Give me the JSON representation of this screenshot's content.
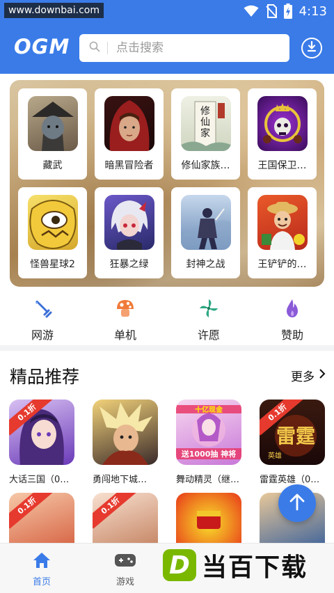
{
  "status_bar": {
    "watermark": "www.downbai.com",
    "time": "4:13"
  },
  "header": {
    "logo": "OGM",
    "search_placeholder": "点击搜索"
  },
  "featured": [
    {
      "name": "藏武",
      "icon": "ronin-portrait"
    },
    {
      "name": "暗黑冒险者",
      "icon": "red-hood-portrait"
    },
    {
      "name": "修仙家族…",
      "icon": "calligraphy-scroll"
    },
    {
      "name": "王国保卫…",
      "icon": "skull-tower"
    },
    {
      "name": "怪兽星球2",
      "icon": "yellow-monster"
    },
    {
      "name": "狂暴之绿",
      "icon": "white-hair-girl"
    },
    {
      "name": "封神之战",
      "icon": "knight-silhouette"
    },
    {
      "name": "王铲铲的…",
      "icon": "farmer-character"
    }
  ],
  "categories": [
    {
      "label": "网游",
      "icon": "sword-icon",
      "color": "#3a6fd8"
    },
    {
      "label": "单机",
      "icon": "mushroom-icon",
      "color": "#f07a3a"
    },
    {
      "label": "许愿",
      "icon": "pinwheel-icon",
      "color": "#2ea884"
    },
    {
      "label": "赞助",
      "icon": "flame-icon",
      "color": "#8a5ad8"
    }
  ],
  "section": {
    "title": "精品推荐",
    "more": "更多"
  },
  "games_row1": [
    {
      "name": "大话三国（0…",
      "tag": "0.1折"
    },
    {
      "name": "勇闯地下城…",
      "tag": ""
    },
    {
      "name": "舞动精灵（继…",
      "tag": ""
    },
    {
      "name": "雷霆英雄（0…",
      "tag": "0.1折"
    }
  ],
  "games_row2": [
    {
      "tag": "0.1折"
    },
    {
      "tag": "0.1折"
    },
    {
      "tag": ""
    },
    {
      "tag": ""
    }
  ],
  "game_banners": {
    "row1_3": "十亿现金 送1000抽 神将",
    "row1_4_title": "雷霆",
    "row1_4_sub": "英雄"
  },
  "bottom_nav": [
    {
      "label": "首页",
      "icon": "home-icon",
      "active": true
    },
    {
      "label": "游戏",
      "icon": "gamepad-icon",
      "active": false
    }
  ],
  "brand": {
    "badge": "D",
    "text": "当百下载"
  },
  "colors": {
    "primary": "#3a7be8",
    "tag_red": "#e63a2e"
  }
}
